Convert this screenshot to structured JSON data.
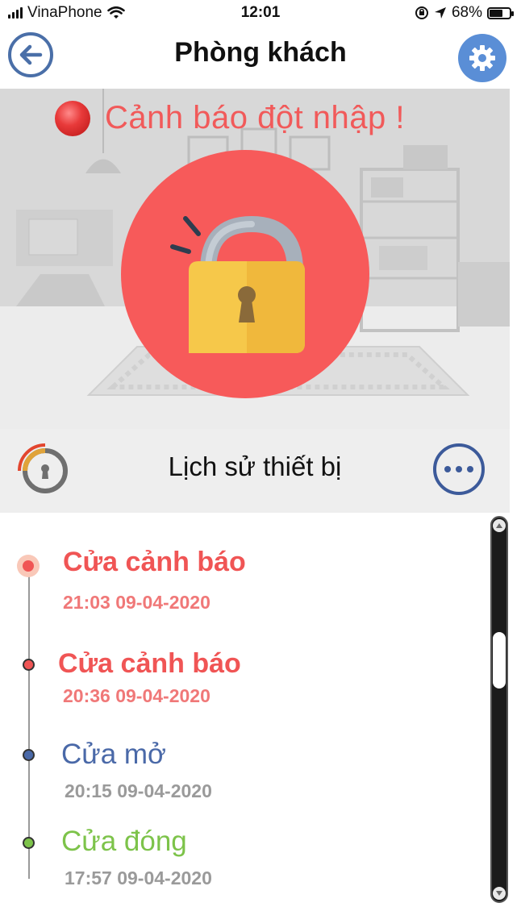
{
  "status_bar": {
    "carrier": "VinaPhone",
    "time": "12:01",
    "battery_percent": "68%",
    "battery_level": 0.68,
    "icons": [
      "signal-icon",
      "wifi-icon",
      "orientation-lock-icon",
      "location-icon",
      "battery-icon"
    ]
  },
  "header": {
    "title": "Phòng khách",
    "back_icon": "arrow-left-icon",
    "settings_icon": "gear-icon"
  },
  "hero": {
    "alert_text": "Cảnh báo đột nhập !",
    "lock_state": "unlocked",
    "colors": {
      "circle": "#f75a5a",
      "alert_text": "#f15a5a",
      "lock_body": "#f6c84a"
    }
  },
  "history": {
    "title": "Lịch sử thiết bị",
    "more_icon": "more-horizontal-icon",
    "items": [
      {
        "title": "Cửa cảnh báo",
        "time": "21:03 09-04-2020",
        "type": "alert",
        "color": "#f05555",
        "time_color": "#f07878"
      },
      {
        "title": "Cửa cảnh báo",
        "time": "20:36 09-04-2020",
        "type": "alert",
        "color": "#f05555",
        "time_color": "#f07878"
      },
      {
        "title": "Cửa mở",
        "time": "20:15 09-04-2020",
        "type": "open",
        "color": "#4a69a8",
        "time_color": "#9a9a9a"
      },
      {
        "title": "Cửa đóng",
        "time": "17:57 09-04-2020",
        "type": "closed",
        "color": "#7dc34a",
        "time_color": "#9a9a9a"
      }
    ]
  }
}
